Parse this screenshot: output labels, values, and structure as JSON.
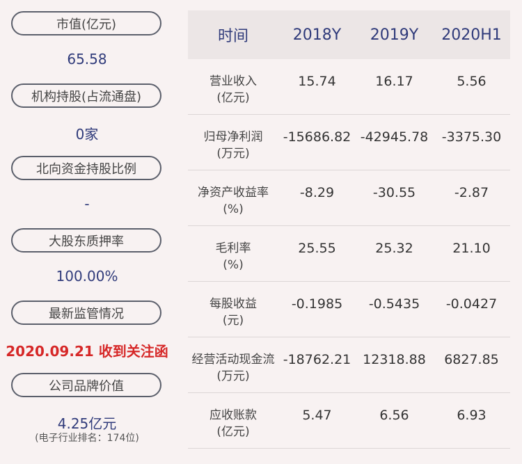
{
  "left": {
    "items": [
      {
        "label": "市值(亿元)",
        "value": "65.58"
      },
      {
        "label": "机构持股(占流通盘)",
        "value": "0家"
      },
      {
        "label": "北向资金持股比例",
        "value": "-"
      },
      {
        "label": "大股东质押率",
        "value": "100.00%"
      },
      {
        "label": "最新监管情况",
        "value": "2020.09.21 收到关注函"
      },
      {
        "label": "公司品牌价值",
        "value": "4.25亿元",
        "note": "(电子行业排名：174位)"
      }
    ]
  },
  "table": {
    "headers": [
      "时间",
      "2018Y",
      "2019Y",
      "2020H1"
    ],
    "rows": [
      {
        "name": "营业收入",
        "unit": "(亿元)",
        "values": [
          "15.74",
          "16.17",
          "5.56"
        ]
      },
      {
        "name": "归母净利润",
        "unit": "(万元)",
        "values": [
          "-15686.82",
          "-42945.78",
          "-3375.30"
        ]
      },
      {
        "name": "净资产收益率",
        "unit": "(%)",
        "values": [
          "-8.29",
          "-30.55",
          "-2.87"
        ]
      },
      {
        "name": "毛利率",
        "unit": "(%)",
        "values": [
          "25.55",
          "25.32",
          "21.10"
        ]
      },
      {
        "name": "每股收益",
        "unit": "(元)",
        "values": [
          "-0.1985",
          "-0.5435",
          "-0.0427"
        ]
      },
      {
        "name": "经营活动现金流",
        "unit": "(万元)",
        "values": [
          "-18762.21",
          "12318.88",
          "6827.85"
        ]
      },
      {
        "name": "应收账款",
        "unit": "(亿元)",
        "values": [
          "5.47",
          "6.56",
          "6.93"
        ]
      }
    ]
  },
  "colors": {
    "accent": "#2f3a7a",
    "alert": "#d62828",
    "background": "#f8f2f2"
  }
}
